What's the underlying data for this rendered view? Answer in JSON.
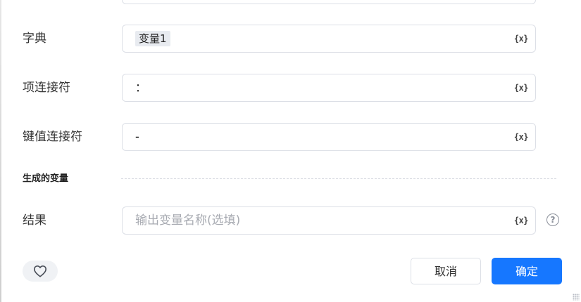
{
  "form": {
    "dictionary": {
      "label": "字典",
      "value": "变量1",
      "icon": "variable-icon",
      "icon_text": "{x}"
    },
    "item_connector": {
      "label": "项连接符",
      "value": "：",
      "icon": "variable-icon",
      "icon_text": "{x}"
    },
    "kv_connector": {
      "label": "键值连接符",
      "value": "-",
      "icon": "variable-icon",
      "icon_text": "{x}"
    }
  },
  "output_section": {
    "title": "生成的变量",
    "result": {
      "label": "结果",
      "value": "",
      "placeholder": "输出变量名称(选填)",
      "icon": "variable-icon",
      "icon_text": "{x}",
      "help_icon": "help-circle-icon",
      "help_text": "?"
    }
  },
  "footer": {
    "favorite_icon": "heart-icon",
    "cancel_label": "取消",
    "confirm_label": "确定"
  },
  "colors": {
    "primary": "#1677ff",
    "border": "#dcdfe6",
    "chip_bg": "#e8ebf0",
    "placeholder": "#a8abb2"
  }
}
